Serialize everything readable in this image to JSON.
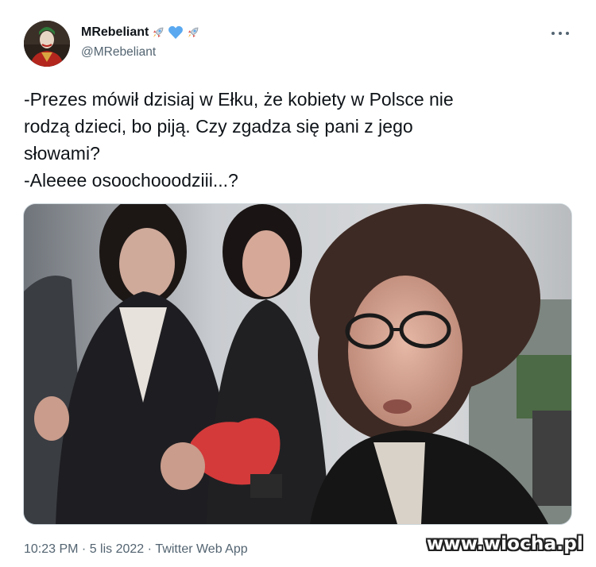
{
  "author": {
    "display_name": "MRebeliant",
    "name_emojis": [
      "rocket-icon",
      "blue-heart-icon",
      "rocket-icon"
    ],
    "handle": "@MRebeliant"
  },
  "tweet": {
    "lines": [
      "-Prezes mówił dzisiaj w Ełku, że kobiety w Polsce nie",
      "rodzą dzieci, bo piją. Czy zgadza się pani z jego",
      "słowami?",
      "-Aleeee osoochooodziii...?"
    ]
  },
  "meta": {
    "time": "10:23 PM",
    "separator": " · ",
    "date": "5 lis 2022",
    "source": "Twitter Web App"
  },
  "watermark": "www.wiocha.pl",
  "colors": {
    "text": "#0f1419",
    "secondary": "#536471",
    "heart": "#5aa9f0",
    "rocket": "#d9534f"
  }
}
